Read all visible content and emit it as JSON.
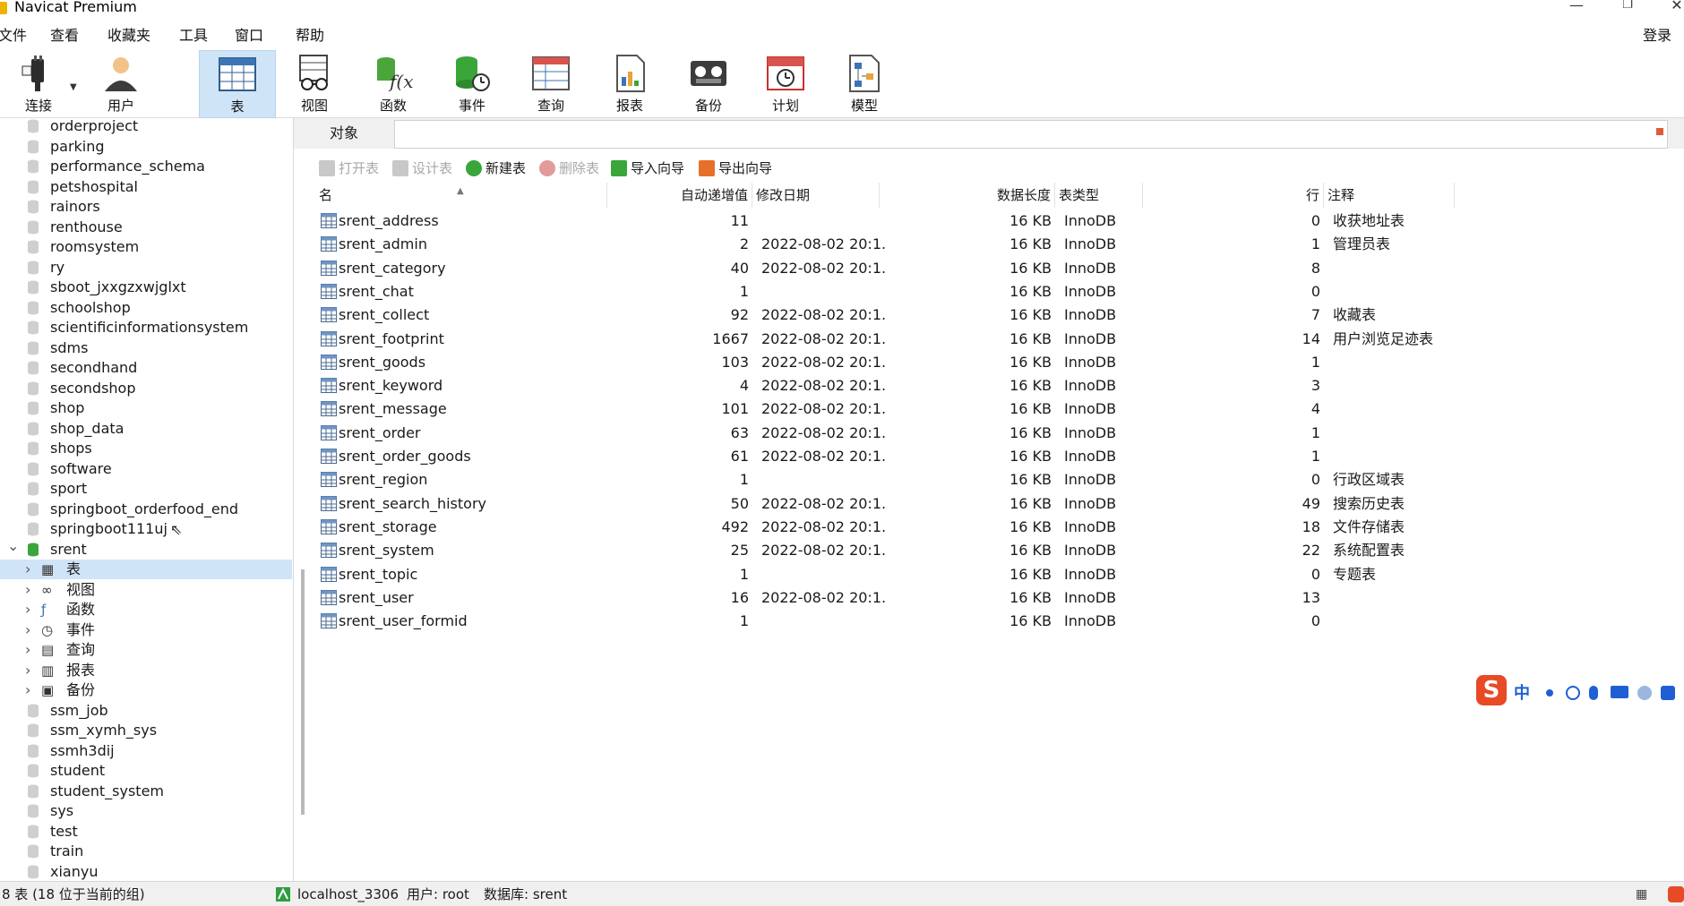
{
  "window": {
    "title": "Navicat Premium",
    "minimize": "—",
    "maximize": "❐",
    "close": "✕"
  },
  "menu": {
    "items": [
      "文件",
      "查看",
      "收藏夹",
      "工具",
      "窗口",
      "帮助"
    ],
    "login": "登录"
  },
  "toolbar": {
    "items": [
      {
        "label": "连接",
        "icon": "plug-icon"
      },
      {
        "label": "用户",
        "icon": "user-icon"
      },
      {
        "label": "表",
        "icon": "table-icon"
      },
      {
        "label": "视图",
        "icon": "view-icon"
      },
      {
        "label": "函数",
        "icon": "function-icon"
      },
      {
        "label": "事件",
        "icon": "event-icon"
      },
      {
        "label": "查询",
        "icon": "query-icon"
      },
      {
        "label": "报表",
        "icon": "report-icon"
      },
      {
        "label": "备份",
        "icon": "backup-icon"
      },
      {
        "label": "计划",
        "icon": "schedule-icon"
      },
      {
        "label": "模型",
        "icon": "model-icon"
      }
    ],
    "active": "表"
  },
  "navigator": {
    "databases_before": [
      "orderproject",
      "parking",
      "performance_schema",
      "petshospital",
      "rainors",
      "renthouse",
      "roomsystem",
      "ry",
      "sboot_jxxgzxwjglxt",
      "schoolshop",
      "scientificinformationsystem",
      "sdms",
      "secondhand",
      "secondshop",
      "shop",
      "shop_data",
      "shops",
      "software",
      "sport",
      "springboot_orderfood_end",
      "springboot111uj"
    ],
    "open_database": "srent",
    "open_children": [
      "表",
      "视图",
      "函数",
      "事件",
      "查询",
      "报表",
      "备份"
    ],
    "databases_after": [
      "ssm_job",
      "ssm_xymh_sys",
      "ssmh3dij",
      "student",
      "student_system",
      "sys",
      "test",
      "train",
      "xianyu"
    ]
  },
  "tabs": {
    "object": "对象"
  },
  "actions": [
    {
      "label": "打开表",
      "enabled": false
    },
    {
      "label": "设计表",
      "enabled": false
    },
    {
      "label": "新建表",
      "enabled": true
    },
    {
      "label": "删除表",
      "enabled": false
    },
    {
      "label": "导入向导",
      "enabled": true
    },
    {
      "label": "导出向导",
      "enabled": true
    }
  ],
  "table": {
    "columns": [
      "名",
      "自动递增值",
      "修改日期",
      "数据长度",
      "表类型",
      "行",
      "注释"
    ],
    "rows": [
      [
        "srent_address",
        "11",
        "",
        "16 KB",
        "InnoDB",
        "0",
        "收获地址表"
      ],
      [
        "srent_admin",
        "2",
        "2022-08-02 20:1...",
        "16 KB",
        "InnoDB",
        "1",
        "管理员表"
      ],
      [
        "srent_category",
        "40",
        "2022-08-02 20:1...",
        "16 KB",
        "InnoDB",
        "8",
        ""
      ],
      [
        "srent_chat",
        "1",
        "",
        "16 KB",
        "InnoDB",
        "0",
        ""
      ],
      [
        "srent_collect",
        "92",
        "2022-08-02 20:1...",
        "16 KB",
        "InnoDB",
        "7",
        "收藏表"
      ],
      [
        "srent_footprint",
        "1667",
        "2022-08-02 20:1...",
        "16 KB",
        "InnoDB",
        "14",
        "用户浏览足迹表"
      ],
      [
        "srent_goods",
        "103",
        "2022-08-02 20:1...",
        "16 KB",
        "InnoDB",
        "1",
        ""
      ],
      [
        "srent_keyword",
        "4",
        "2022-08-02 20:1...",
        "16 KB",
        "InnoDB",
        "3",
        ""
      ],
      [
        "srent_message",
        "101",
        "2022-08-02 20:1...",
        "16 KB",
        "InnoDB",
        "4",
        ""
      ],
      [
        "srent_order",
        "63",
        "2022-08-02 20:1...",
        "16 KB",
        "InnoDB",
        "1",
        ""
      ],
      [
        "srent_order_goods",
        "61",
        "2022-08-02 20:1...",
        "16 KB",
        "InnoDB",
        "1",
        ""
      ],
      [
        "srent_region",
        "1",
        "",
        "16 KB",
        "InnoDB",
        "0",
        "行政区域表"
      ],
      [
        "srent_search_history",
        "50",
        "2022-08-02 20:1...",
        "16 KB",
        "InnoDB",
        "49",
        "搜索历史表"
      ],
      [
        "srent_storage",
        "492",
        "2022-08-02 20:1...",
        "16 KB",
        "InnoDB",
        "18",
        "文件存储表"
      ],
      [
        "srent_system",
        "25",
        "2022-08-02 20:1...",
        "16 KB",
        "InnoDB",
        "22",
        "系统配置表"
      ],
      [
        "srent_topic",
        "1",
        "",
        "16 KB",
        "InnoDB",
        "0",
        "专题表"
      ],
      [
        "srent_user",
        "16",
        "2022-08-02 20:1...",
        "16 KB",
        "InnoDB",
        "13",
        ""
      ],
      [
        "srent_user_formid",
        "1",
        "",
        "16 KB",
        "InnoDB",
        "0",
        ""
      ]
    ]
  },
  "ime": {
    "logo": "S",
    "mode": "中"
  },
  "status": {
    "count": "8 表 (18 位于当前的组)",
    "connection": "localhost_3306",
    "user": "用户: root",
    "database": "数据库: srent"
  },
  "colors": {
    "selection": "#cfe4f7",
    "accent_green": "#3aa63a",
    "ime_red": "#e84a26"
  }
}
